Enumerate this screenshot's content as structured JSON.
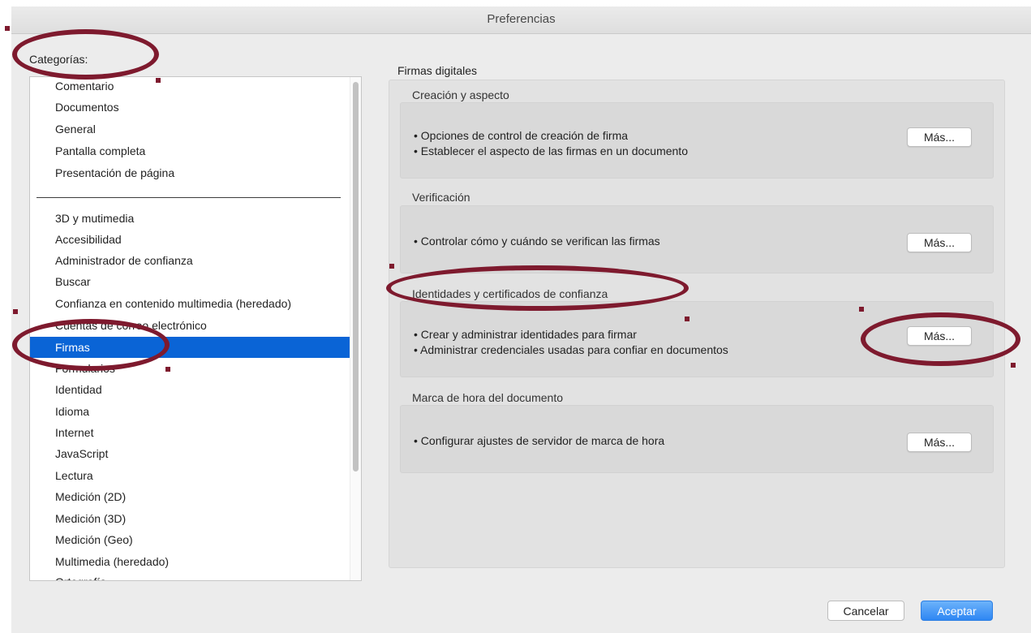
{
  "window": {
    "title": "Preferencias"
  },
  "categories": {
    "label": "Categorías:",
    "group1": [
      "Comentario",
      "Documentos",
      "General",
      "Pantalla completa",
      "Presentación de página"
    ],
    "group2": [
      "3D y mutimedia",
      "Accesibilidad",
      "Administrador de confianza",
      "Buscar",
      "Confianza en contenido multimedia (heredado)",
      "Cuentas de correo electrónico",
      "Firmas",
      "Formularios",
      "Identidad",
      "Idioma",
      "Internet",
      "JavaScript",
      "Lectura",
      "Medición (2D)",
      "Medición (3D)",
      "Medición (Geo)",
      "Multimedia (heredado)",
      "Ortografía"
    ],
    "selected": "Firmas"
  },
  "signatures": {
    "heading": "Firmas digitales",
    "sections": [
      {
        "title": "Creación y aspecto",
        "lines": [
          "• Opciones de control de creación de firma",
          "• Establecer el aspecto de las firmas en un documento"
        ],
        "button": "Más..."
      },
      {
        "title": "Verificación",
        "lines": [
          "• Controlar cómo y cuándo se verifican las firmas"
        ],
        "button": "Más..."
      },
      {
        "title": "Identidades y certificados de confianza",
        "lines": [
          "• Crear y administrar identidades para firmar",
          "• Administrar credenciales usadas para confiar en documentos"
        ],
        "button": "Más..."
      },
      {
        "title": "Marca de hora del documento",
        "lines": [
          "• Configurar ajustes de servidor de marca de hora"
        ],
        "button": "Más..."
      }
    ]
  },
  "footer": {
    "cancel": "Cancelar",
    "accept": "Aceptar"
  },
  "colors": {
    "selection": "#0a64d6",
    "annotation": "#7e1a2e",
    "accept": "#2e86f3"
  }
}
